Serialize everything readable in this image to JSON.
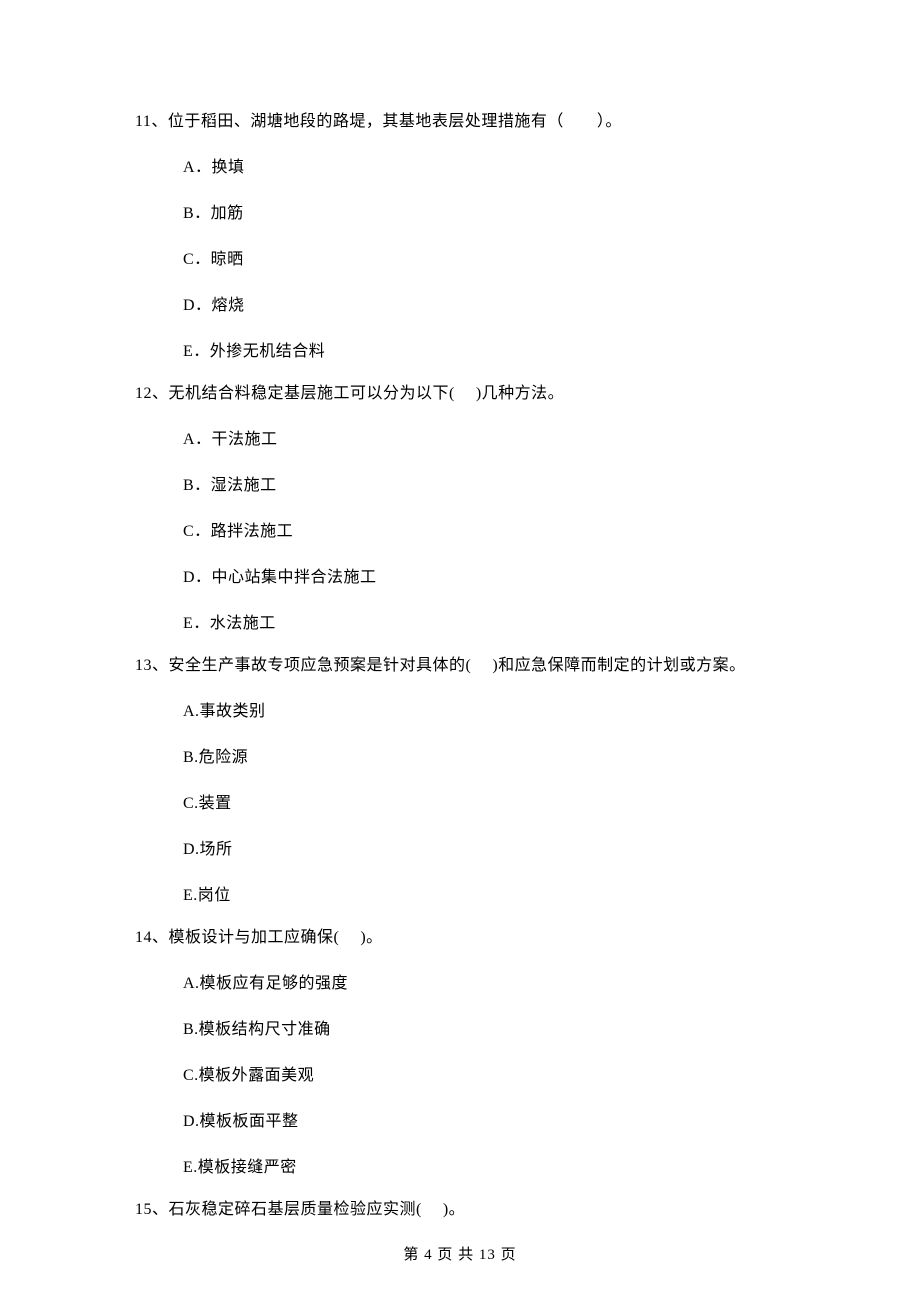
{
  "questions": [
    {
      "number": "11、",
      "stem": "位于稻田、湖塘地段的路堤，其基地表层处理措施有（　　）。",
      "options": [
        "A．换填",
        "B．加筋",
        "C．晾晒",
        "D．熔烧",
        "E．外掺无机结合料"
      ]
    },
    {
      "number": "12、",
      "stem": "无机结合料稳定基层施工可以分为以下(　 )几种方法。",
      "options": [
        "A．干法施工",
        "B．湿法施工",
        "C．路拌法施工",
        "D．中心站集中拌合法施工",
        "E．水法施工"
      ]
    },
    {
      "number": "13、",
      "stem": "安全生产事故专项应急预案是针对具体的(　 )和应急保障而制定的计划或方案。",
      "options": [
        "A.事故类别",
        "B.危险源",
        "C.装置",
        "D.场所",
        "E.岗位"
      ]
    },
    {
      "number": "14、",
      "stem": "模板设计与加工应确保(　 )。",
      "options": [
        "A.模板应有足够的强度",
        "B.模板结构尺寸准确",
        "C.模板外露面美观",
        "D.模板板面平整",
        "E.模板接缝严密"
      ]
    },
    {
      "number": "15、",
      "stem": "石灰稳定碎石基层质量检验应实测(　 )。",
      "options": []
    }
  ],
  "footer": "第 4 页 共 13 页"
}
